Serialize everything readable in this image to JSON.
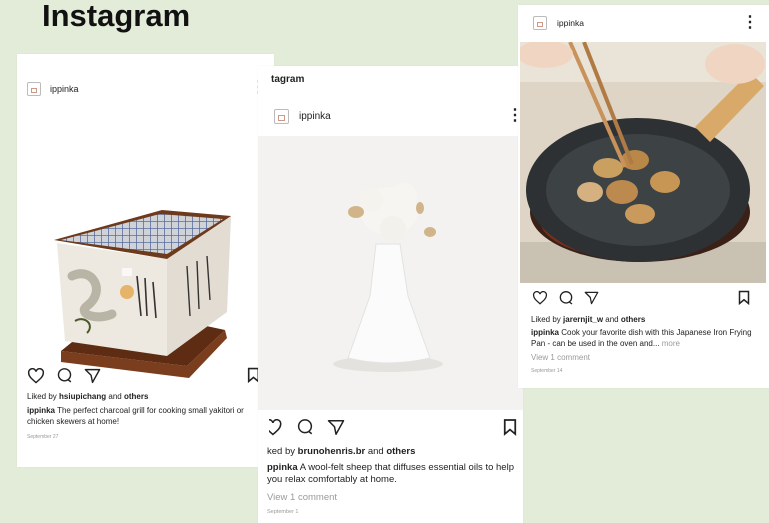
{
  "page": {
    "title": "Instagram"
  },
  "posts": [
    {
      "username": "ippinka",
      "liked_prefix": "Liked by ",
      "liked_user": "hsiupichang",
      "liked_and": " and ",
      "liked_others": "others",
      "caption_user": "ippinka",
      "caption_text": " The perfect charcoal grill for cooking small yakitori or chicken skewers at home!",
      "date": "September 27"
    },
    {
      "header_title": "tagram",
      "username": "ippinka",
      "liked_prefix": "ked by ",
      "liked_user": "brunohenris.br",
      "liked_and": " and ",
      "liked_others": "others",
      "caption_user": "ppinka",
      "caption_text": " A wool-felt sheep that diffuses essential oils to help you relax comfortably at home.",
      "view_comments": "View 1 comment",
      "date": "September 1"
    },
    {
      "username": "ippinka",
      "liked_prefix": "Liked by ",
      "liked_user": "jarernjit_w",
      "liked_and": " and ",
      "liked_others": "others",
      "caption_user": "ippinka",
      "caption_text": " Cook your favorite dish with this Japanese Iron Frying Pan - can be used in the oven and...",
      "more": " more",
      "view_comments": "View 1 comment",
      "date": "September 14"
    }
  ]
}
